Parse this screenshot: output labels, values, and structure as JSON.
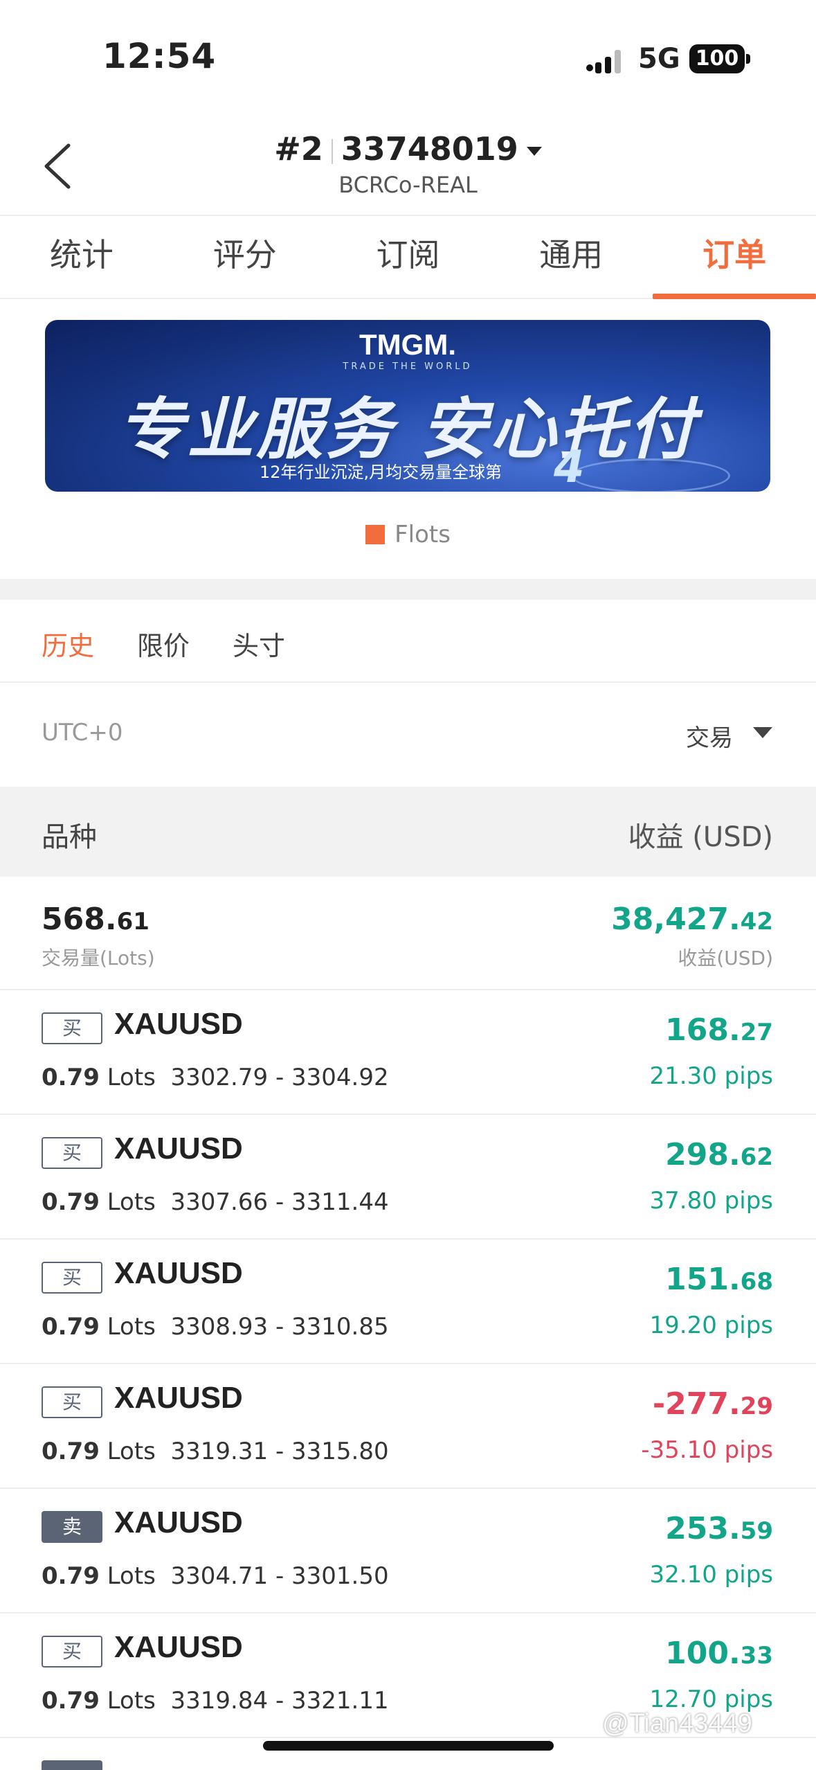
{
  "status_bar": {
    "time": "12:54",
    "network": "5G",
    "battery": "100"
  },
  "header": {
    "account_prefix": "#2",
    "account_number": "33748019",
    "server": "BCRCo-REAL"
  },
  "tabs": [
    {
      "label": "统计"
    },
    {
      "label": "评分"
    },
    {
      "label": "订阅"
    },
    {
      "label": "通用"
    },
    {
      "label": "订单"
    }
  ],
  "banner": {
    "logo": "TMGM.",
    "tagline": "TRADE THE WORLD",
    "headline": "专业服务 安心托付",
    "subline": "12年行业沉淀,月均交易量全球第",
    "rank": "4"
  },
  "legend": {
    "label": "Flots",
    "color": "#f26d3d"
  },
  "order_tabs": [
    {
      "label": "历史"
    },
    {
      "label": "限价"
    },
    {
      "label": "头寸"
    }
  ],
  "filter": {
    "timezone": "UTC+0",
    "type": "交易"
  },
  "table_header": {
    "symbol": "品种",
    "profit": "收益 (USD)"
  },
  "summary": {
    "volume_int": "568.",
    "volume_dec": "61",
    "volume_label": "交易量(Lots)",
    "profit_int": "38,427.",
    "profit_dec": "42",
    "profit_label": "收益(USD)"
  },
  "trades": [
    {
      "side": "买",
      "symbol": "XAUUSD",
      "lots": "0.79",
      "lots_unit": "Lots",
      "prices": "3302.79 - 3304.92",
      "profit_int": "168.",
      "profit_dec": "27",
      "pips": "21.30 pips"
    },
    {
      "side": "买",
      "symbol": "XAUUSD",
      "lots": "0.79",
      "lots_unit": "Lots",
      "prices": "3307.66 - 3311.44",
      "profit_int": "298.",
      "profit_dec": "62",
      "pips": "37.80 pips"
    },
    {
      "side": "买",
      "symbol": "XAUUSD",
      "lots": "0.79",
      "lots_unit": "Lots",
      "prices": "3308.93 - 3310.85",
      "profit_int": "151.",
      "profit_dec": "68",
      "pips": "19.20 pips"
    },
    {
      "side": "买",
      "symbol": "XAUUSD",
      "lots": "0.79",
      "lots_unit": "Lots",
      "prices": "3319.31 - 3315.80",
      "profit_int": "-277.",
      "profit_dec": "29",
      "pips": "-35.10 pips"
    },
    {
      "side": "卖",
      "symbol": "XAUUSD",
      "lots": "0.79",
      "lots_unit": "Lots",
      "prices": "3304.71 - 3301.50",
      "profit_int": "253.",
      "profit_dec": "59",
      "pips": "32.10 pips"
    },
    {
      "side": "买",
      "symbol": "XAUUSD",
      "lots": "0.79",
      "lots_unit": "Lots",
      "prices": "3319.84 - 3321.11",
      "profit_int": "100.",
      "profit_dec": "33",
      "pips": "12.70 pips"
    }
  ],
  "colors": {
    "accent": "#f26d3d",
    "positive": "#13a58a",
    "negative": "#e0445a"
  },
  "watermark": "@Tian43449"
}
